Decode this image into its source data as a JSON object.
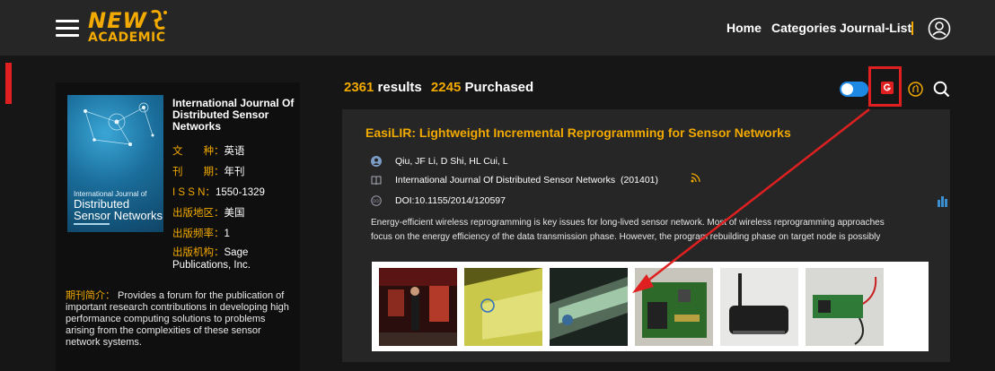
{
  "header": {
    "logo": {
      "word": "NEW",
      "sub": "ACADEMIC"
    },
    "nav": [
      "Home",
      "Categories",
      "Journal-List"
    ],
    "icons": {
      "menu": "hamburger-menu-icon",
      "user": "user-circle-icon"
    }
  },
  "journal": {
    "title": "International Journal Of Distributed Sensor Networks",
    "cover": {
      "small": "International Journal of",
      "big": "Distributed Sensor Networks"
    },
    "meta": [
      {
        "label": "文　　种：",
        "value": "英语"
      },
      {
        "label": "刊　　期：",
        "value": "年刊"
      },
      {
        "label": "I S S N：",
        "value": "1550-1329"
      },
      {
        "label": "出版地区：",
        "value": "美国"
      },
      {
        "label": "出版频率：",
        "value": "1"
      },
      {
        "label": "出版机构：",
        "value": "Sage Publications, Inc."
      }
    ],
    "intro_label": "期刊简介：",
    "intro_text": " Provides a forum for the publication of important research contributions in developing high performance computing solutions to problems arising from the complexities of these sensor network systems."
  },
  "results": {
    "count": "2361",
    "count_label": "results",
    "purchased": "2245",
    "purchased_label": "Purchased",
    "toggle_on": true
  },
  "article": {
    "title": "EasiLIR: Lightweight Incremental Reprogramming for Sensor Networks",
    "authors": "Qiu, JF  Li, D  Shi, HL  Cui, L",
    "journal": "International Journal Of Distributed Sensor Networks",
    "year": "(201401)",
    "doi": "DOI:10.1155/2014/120597",
    "abstract_line1": "Energy-efficient wireless reprogramming is key issues for long-lived sensor network. Most of wireless reprogramming approaches",
    "abstract_line2": "focus on the energy efficiency of the data transmission phase. However, the program rebuilding phase on target node is possibly",
    "images": [
      "photo-museum-scene",
      "photo-yellow-panel",
      "photo-glass-display",
      "photo-circuit-board",
      "photo-router-device",
      "photo-sensor-board"
    ]
  },
  "colors": {
    "accent": "#f2a900",
    "highlight": "#e02020",
    "toggle": "#1e88e5"
  }
}
